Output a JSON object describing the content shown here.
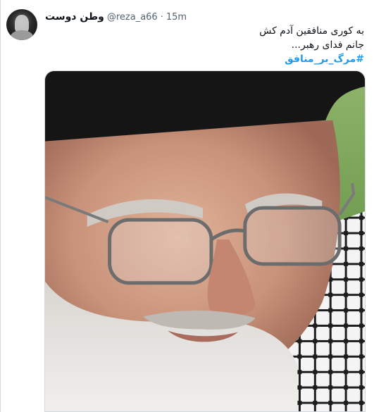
{
  "tweet": {
    "author": {
      "display_name": "وطن دوست",
      "handle": "@reza_a66",
      "avatar_icon": "avatar-photo"
    },
    "separator": "·",
    "timestamp": "15m",
    "text_lines": [
      "به کوری منافقین آدم کش",
      "جانم فدای رهبر..."
    ],
    "hashtag": "#مرگ_بر_منافق",
    "media": {
      "kind": "photo",
      "description_icon": "photo-image"
    }
  },
  "colors": {
    "link": "#1d9bf0",
    "secondary_text": "#536471",
    "primary_text": "#0f1419",
    "border": "#cfd9de"
  }
}
